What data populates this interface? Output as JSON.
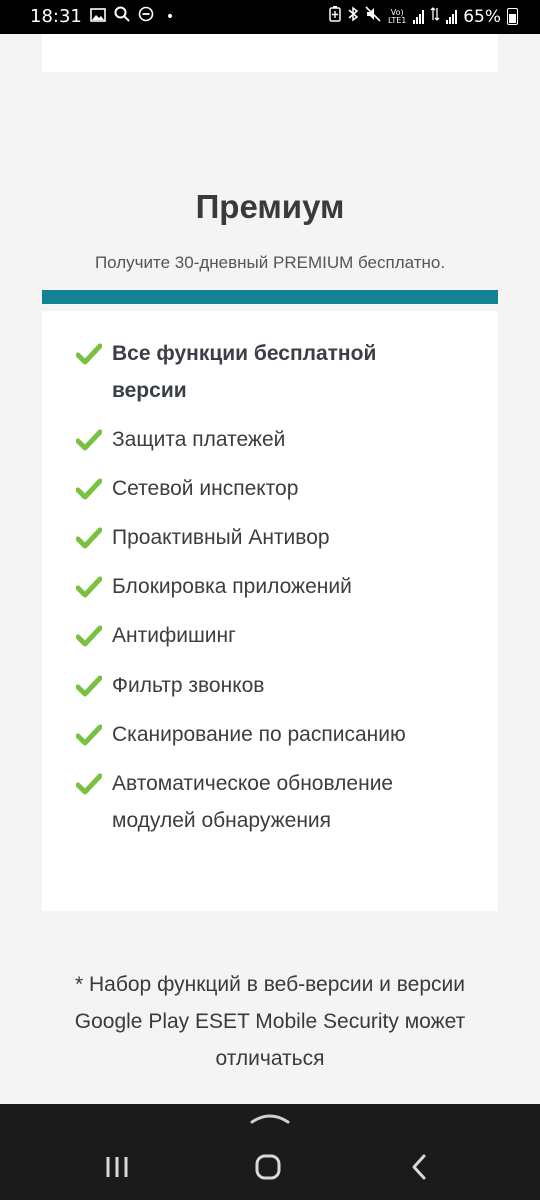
{
  "status_bar": {
    "time": "18:31",
    "dot": "•",
    "lte_label": "Vo) LTE1",
    "battery_percent": "65%",
    "icons": [
      "gallery-icon",
      "search-icon",
      "dnd-icon",
      "battery-saver-icon",
      "bluetooth-icon",
      "mute-icon",
      "signal-icon",
      "data-icon",
      "battery-icon"
    ]
  },
  "premium": {
    "title": "Премиум",
    "subtitle": "Получите 30-дневный PREMIUM бесплатно.",
    "accent_color": "#138394",
    "check_color": "#7ac142",
    "features": [
      {
        "lines": [
          "Все функции бесплатной",
          "версии"
        ],
        "bold": true
      },
      {
        "lines": [
          "Защита платежей"
        ],
        "bold": false
      },
      {
        "lines": [
          "Сетевой инспектор"
        ],
        "bold": false
      },
      {
        "lines": [
          "Проактивный Антивор"
        ],
        "bold": false
      },
      {
        "lines": [
          "Блокировка приложений"
        ],
        "bold": false
      },
      {
        "lines": [
          "Антифишинг"
        ],
        "bold": false
      },
      {
        "lines": [
          "Фильтр звонков"
        ],
        "bold": false
      },
      {
        "lines": [
          "Сканирование по расписанию"
        ],
        "bold": false
      },
      {
        "lines": [
          "Автоматическое обновление",
          "модулей обнаружения"
        ],
        "bold": false
      }
    ]
  },
  "footnote": {
    "lines": [
      "* Набор функций в веб-версии и версии",
      "Google Play ESET Mobile Security может",
      "отличаться"
    ]
  },
  "nav_bar": {
    "buttons": [
      "recent-apps-icon",
      "home-icon",
      "back-icon"
    ]
  }
}
